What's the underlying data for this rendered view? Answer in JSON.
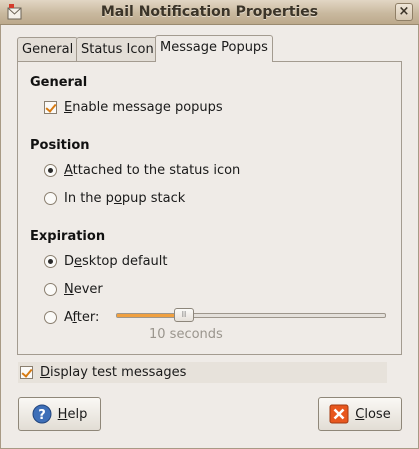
{
  "window": {
    "title": "Mail Notification Properties",
    "close_glyph": "×"
  },
  "tabs": [
    {
      "label": "General",
      "active": false
    },
    {
      "label": "Status Icon",
      "active": false
    },
    {
      "label": "Message Popups",
      "active": true
    }
  ],
  "general": {
    "heading": "General",
    "enable_popups": {
      "label_key": "E",
      "label_rest": "nable message popups",
      "checked": true
    }
  },
  "position": {
    "heading": "Position",
    "attached": {
      "label_key": "A",
      "label_rest": "ttached to the status icon",
      "selected": true
    },
    "stack": {
      "label_pre": "In the p",
      "label_key": "o",
      "label_rest": "pup stack",
      "selected": false
    }
  },
  "expiration": {
    "heading": "Expiration",
    "desktop_default": {
      "label_pre": "D",
      "label_key": "e",
      "label_rest": "sktop default",
      "selected": true
    },
    "never": {
      "label_key": "N",
      "label_rest": "ever",
      "selected": false
    },
    "after": {
      "label_pre": "A",
      "label_key": "f",
      "label_rest": "ter:",
      "selected": false
    },
    "slider": {
      "fraction": 0.25,
      "value_text": "10 seconds",
      "grip_glyph": "ll"
    }
  },
  "test_messages": {
    "label_key": "D",
    "label_rest": "isplay test messages",
    "checked": true
  },
  "buttons": {
    "help": {
      "label_key": "H",
      "label_rest": "elp",
      "icon": "help-icon"
    },
    "close": {
      "label_key": "C",
      "label_rest": "lose",
      "icon": "close-icon"
    }
  },
  "colors": {
    "accent": "#f0a040",
    "check": "#d87b12",
    "help_icon": "#3e6fb8",
    "close_icon": "#e8571e"
  }
}
